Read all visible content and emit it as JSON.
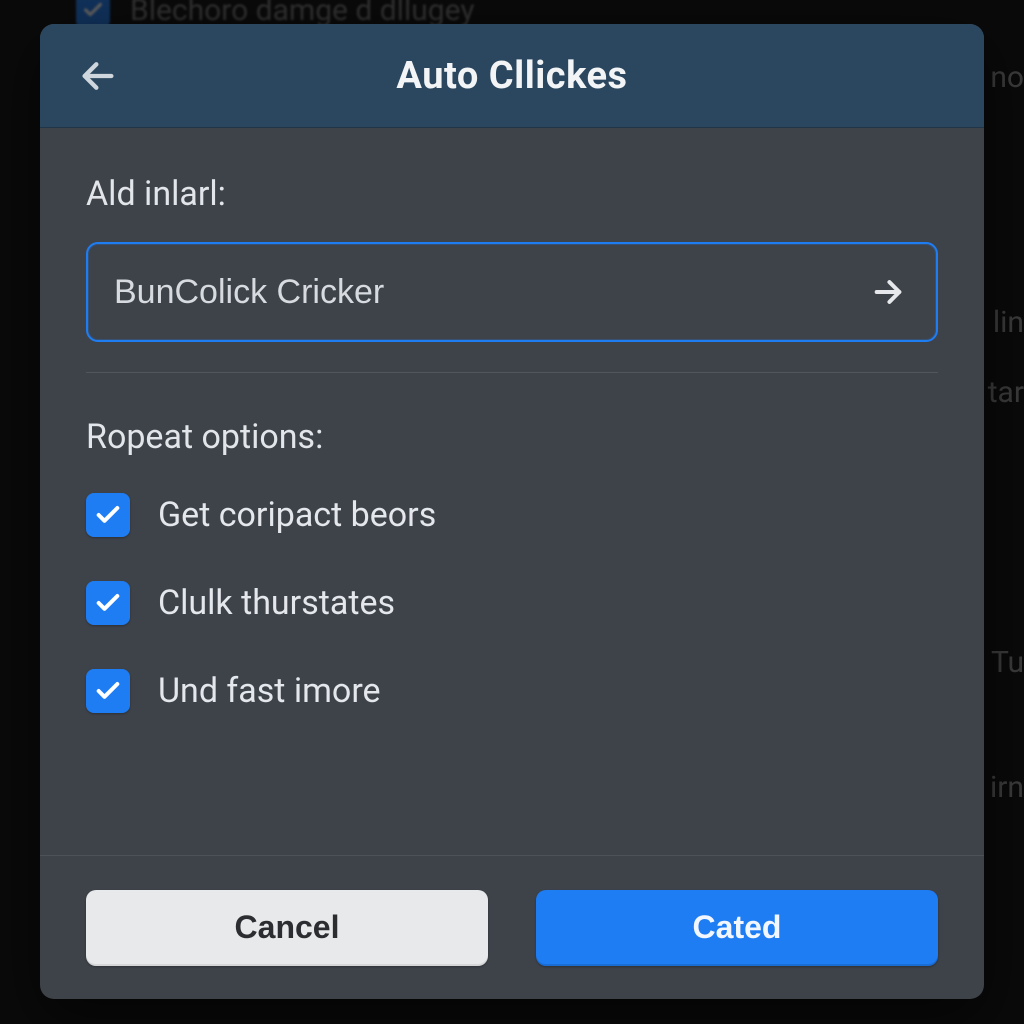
{
  "background": {
    "top_item_label": "Blechoro damge d dllugey",
    "side_fragments": [
      "no",
      "lin",
      "tar",
      "Tu",
      "irn"
    ]
  },
  "modal": {
    "title": "Auto Cllickes",
    "field_label": "Ald inlarl:",
    "input_value": "BunColick Cricker",
    "section_label": "Ropeat options:",
    "options": [
      {
        "label": "Get coripact beors",
        "checked": true
      },
      {
        "label": "Clulk thurstates",
        "checked": true
      },
      {
        "label": "Und fast imore",
        "checked": true
      }
    ],
    "buttons": {
      "cancel": "Cancel",
      "confirm": "Cated"
    }
  },
  "colors": {
    "accent": "#1f7df4",
    "modal_bg": "#3e434a",
    "header_bg": "#2b475f"
  }
}
